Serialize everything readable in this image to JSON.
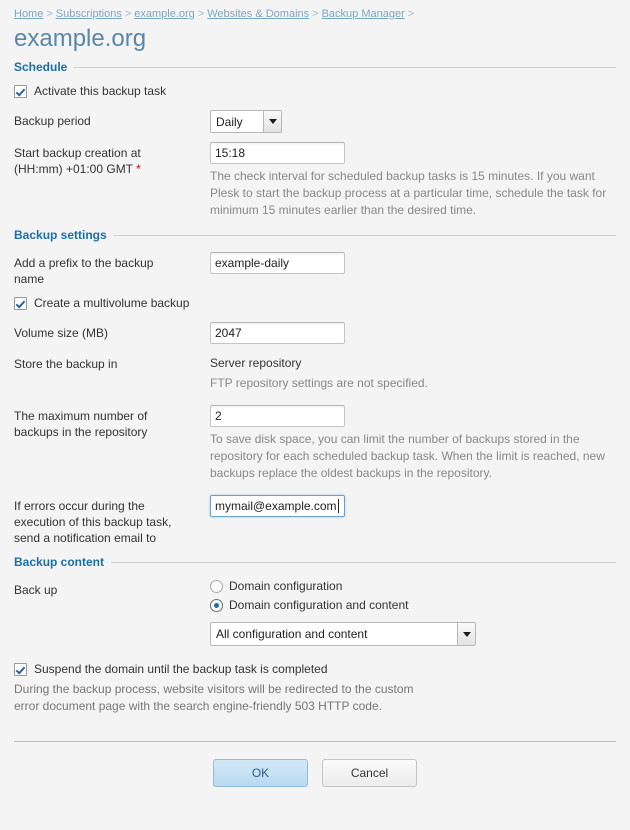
{
  "breadcrumb": {
    "items": [
      {
        "label": "Home"
      },
      {
        "label": "Subscriptions"
      },
      {
        "label": "example.org"
      },
      {
        "label": "Websites & Domains"
      },
      {
        "label": "Backup Manager"
      }
    ],
    "separator": ">"
  },
  "page_title": "example.org",
  "sections": {
    "schedule": {
      "title": "Schedule",
      "activate_checkbox": {
        "label": "Activate this backup task",
        "checked": true
      },
      "backup_period": {
        "label": "Backup period",
        "value": "Daily"
      },
      "start_time": {
        "label_line1": "Start backup creation at",
        "label_line2": "(HH:mm) +01:00 GMT",
        "required_marker": "*",
        "value": "15:18",
        "hint": "The check interval for scheduled backup tasks is 15 minutes. If you want Plesk to start the backup process at a particular time, schedule the task for minimum 15 minutes earlier than the desired time."
      }
    },
    "backup_settings": {
      "title": "Backup settings",
      "prefix": {
        "label_line1": "Add a prefix to the backup",
        "label_line2": "name",
        "value": "example-daily"
      },
      "multivolume_checkbox": {
        "label": "Create a multivolume backup",
        "checked": true
      },
      "volume_size": {
        "label": "Volume size (MB)",
        "value": "2047"
      },
      "store_in": {
        "label": "Store the backup in",
        "value": "Server repository",
        "hint": "FTP repository settings are not specified."
      },
      "max_backups": {
        "label_line1": "The maximum number of",
        "label_line2": "backups in the repository",
        "value": "2",
        "hint": "To save disk space, you can limit the number of backups stored in the repository for each scheduled backup task. When the limit is reached, new backups replace the oldest backups in the repository."
      },
      "notification_email": {
        "label_line1": "If errors occur during the",
        "label_line2": "execution of this backup task,",
        "label_line3": "send a notification email to",
        "value": "mymail@example.com",
        "focused": true
      }
    },
    "backup_content": {
      "title": "Backup content",
      "back_up": {
        "label": "Back up",
        "options": [
          {
            "label": "Domain configuration",
            "selected": false
          },
          {
            "label": "Domain configuration and content",
            "selected": true
          }
        ]
      },
      "content_select": {
        "value": "All configuration and content"
      },
      "suspend_checkbox": {
        "label": "Suspend the domain until the backup task is completed",
        "checked": true
      },
      "suspend_hint": "During the backup process, website visitors will be redirected to the custom error document page with the search engine-friendly 503 HTTP code."
    }
  },
  "footer": {
    "ok_label": "OK",
    "cancel_label": "Cancel"
  },
  "colors": {
    "page_background": "#f4f4f4",
    "section_heading": "#1a6fa8",
    "page_title": "#5a87a8",
    "link": "#7aa7c0",
    "required": "#cc0000",
    "hint_text": "#888888",
    "accent": "#1a6fa8"
  }
}
